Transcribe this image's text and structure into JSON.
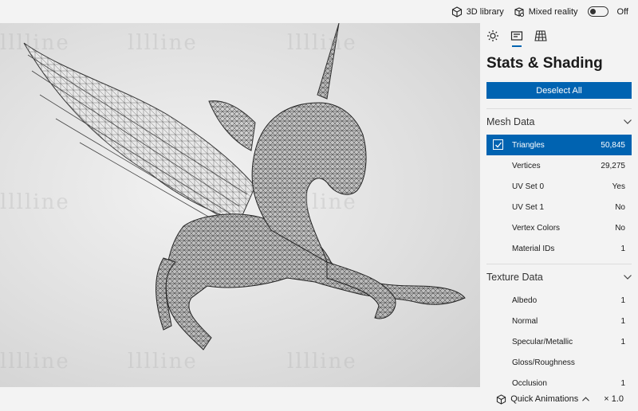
{
  "topbar": {
    "library_label": "3D library",
    "mixed_reality_label": "Mixed reality",
    "toggle_state": "Off"
  },
  "viewport": {
    "watermark": "lllline"
  },
  "panel": {
    "title": "Stats & Shading",
    "deselect_label": "Deselect All",
    "mesh_section": "Mesh Data",
    "mesh_rows": [
      {
        "label": "Triangles",
        "value": "50,845"
      },
      {
        "label": "Vertices",
        "value": "29,275"
      },
      {
        "label": "UV Set 0",
        "value": "Yes"
      },
      {
        "label": "UV Set 1",
        "value": "No"
      },
      {
        "label": "Vertex Colors",
        "value": "No"
      },
      {
        "label": "Material IDs",
        "value": "1"
      }
    ],
    "texture_section": "Texture Data",
    "texture_rows": [
      {
        "label": "Albedo",
        "value": "1"
      },
      {
        "label": "Normal",
        "value": "1"
      },
      {
        "label": "Specular/Metallic",
        "value": "1"
      },
      {
        "label": "Gloss/Roughness",
        "value": ""
      },
      {
        "label": "Occlusion",
        "value": "1"
      }
    ]
  },
  "bottombar": {
    "quick_animations": "Quick Animations",
    "speed": "× 1.0"
  },
  "colors": {
    "accent": "#0063b1"
  }
}
